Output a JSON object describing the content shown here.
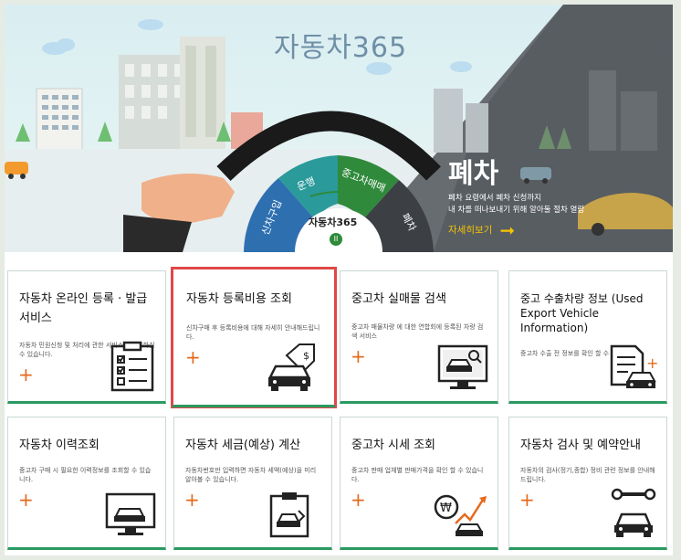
{
  "hero": {
    "site_title": "자동차365",
    "wheel_segments": [
      "신차구입",
      "운행",
      "중고차매매",
      "폐차"
    ],
    "wheel_logo": "자동차365",
    "promo": {
      "title": "폐차",
      "desc_line1": "폐차 요령에서 폐차 신청까지",
      "desc_line2": "내 차를 떠나보내기 위해 알아둘 절차 열람",
      "link": "자세히보기"
    },
    "pause_glyph": "II"
  },
  "cards": [
    {
      "title": "자동차 온라인 등록 · 발급 서비스",
      "desc": "자동차 민원신청 및 처리에 관한 서비스를 이용하실 수 있습니다.",
      "plus": "+",
      "icon": "clipboard-checklist-icon"
    },
    {
      "title": "자동차 등록비용 조회",
      "desc": "신차구매 후 등록비용에 대해 자세히 안내해드립니다.",
      "plus": "+",
      "icon": "car-price-tag-icon"
    },
    {
      "title": "중고차 실매물 검색",
      "desc": "중고차 매물차량 에 대한 연합회에 등록된 차량 검색 서비스",
      "plus": "+",
      "icon": "monitor-car-search-icon"
    },
    {
      "title": "중고 수출차량 정보 (Used Export Vehicle Information)",
      "desc": "중고차 수출 전 정보를 확인 할 수 있습니다.",
      "plus": "+",
      "icon": "document-car-icon"
    },
    {
      "title": "자동차 이력조회",
      "desc": "중고차 구매 시 필요한 이력정보를 조회할 수 있습니다.",
      "plus": "+",
      "icon": "monitor-car-icon"
    },
    {
      "title": "자동차 세금(예상) 계산",
      "desc": "자동차번호만 입력하면 자동차 세액(예상)을 미리 알아볼 수 있습니다.",
      "plus": "+",
      "icon": "clipboard-car-icon"
    },
    {
      "title": "중고차 시세 조회",
      "desc": "중고차 판매 업체별 판매가격을 확인 할 수 있습니다.",
      "plus": "+",
      "icon": "won-trend-car-icon"
    },
    {
      "title": "자동차 검사 및 예약안내",
      "desc": "자동차의 검사(정기,종합) 정비 관련 정보를 안내해드립니다.",
      "plus": "+",
      "icon": "wrench-car-icon"
    }
  ],
  "colors": {
    "accent_green": "#2a9a62",
    "plus_orange": "#e56a1c",
    "active_border": "#e04848",
    "promo_link": "#f5c400"
  }
}
